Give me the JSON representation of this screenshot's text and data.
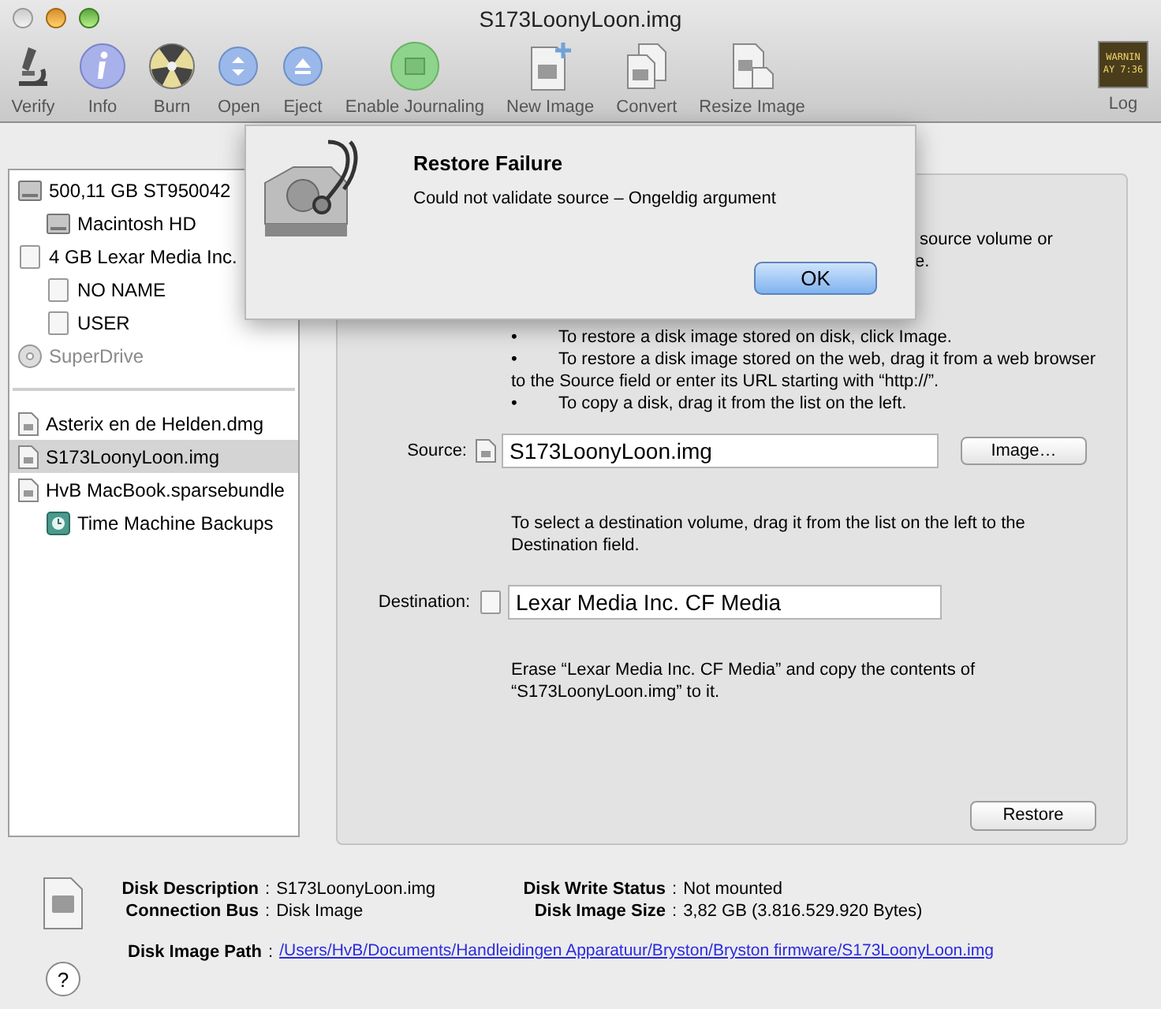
{
  "window": {
    "title": "S173LoonyLoon.img"
  },
  "toolbar": {
    "items": [
      {
        "label": "Verify",
        "kind": "microscope"
      },
      {
        "label": "Info",
        "kind": "info"
      },
      {
        "label": "Burn",
        "kind": "burn"
      },
      {
        "label": "Open",
        "kind": "open"
      },
      {
        "label": "Eject",
        "kind": "eject"
      },
      {
        "label": "Enable Journaling",
        "kind": "journal"
      },
      {
        "label": "New Image",
        "kind": "newimage"
      },
      {
        "label": "Convert",
        "kind": "convert"
      },
      {
        "label": "Resize Image",
        "kind": "resize"
      }
    ],
    "log": {
      "label": "Log",
      "screen_lines": [
        "WARNIN",
        "AY 7:36"
      ]
    }
  },
  "sidebar": {
    "groups": [
      {
        "items": [
          {
            "label": "500,11 GB ST950042",
            "kind": "disk",
            "selected": false,
            "disabled": false,
            "children": [
              {
                "label": "Macintosh HD",
                "kind": "disk",
                "selected": false,
                "disabled": false
              }
            ]
          },
          {
            "label": "4 GB Lexar Media Inc.",
            "kind": "removable",
            "selected": false,
            "disabled": false,
            "children": [
              {
                "label": "NO NAME",
                "kind": "removable",
                "selected": false,
                "disabled": false
              },
              {
                "label": "USER",
                "kind": "removable",
                "selected": false,
                "disabled": false
              }
            ]
          },
          {
            "label": "SuperDrive",
            "kind": "optical",
            "selected": false,
            "disabled": true
          }
        ]
      },
      {
        "items": [
          {
            "label": "Asterix en de Helden.dmg",
            "kind": "image",
            "selected": false,
            "disabled": false
          },
          {
            "label": "S173LoonyLoon.img",
            "kind": "image",
            "selected": true,
            "disabled": false
          },
          {
            "label": "HvB MacBook.sparsebundle",
            "kind": "image",
            "selected": false,
            "disabled": false,
            "children": [
              {
                "label": "Time Machine Backups",
                "kind": "timemachine",
                "selected": false,
                "disabled": false
              }
            ]
          }
        ]
      }
    ]
  },
  "restore_panel": {
    "intro_fragments": [
      "source volume or",
      "e."
    ],
    "source_help": [
      {
        "bullet": "•",
        "text": "To restore a disk image stored on disk, click Image."
      },
      {
        "bullet": "•",
        "text": "To restore a disk image stored on the web, drag it from a web browser to the Source field or enter its URL starting with “http://”."
      },
      {
        "bullet": "•",
        "text": "To copy a disk, drag it from the list on the left."
      }
    ],
    "source": {
      "label": "Source:",
      "value": "S173LoonyLoon.img",
      "button": "Image…"
    },
    "destination_help": "To select a destination volume, drag it from the list on the left to the Destination field.",
    "destination": {
      "label": "Destination:",
      "value": "Lexar Media Inc. CF Media"
    },
    "summary": "Erase “Lexar Media Inc. CF Media” and copy the contents of “S173LoonyLoon.img” to it.",
    "restore_button": "Restore"
  },
  "alert": {
    "title": "Restore Failure",
    "message": "Could not validate source – Ongeldig argument",
    "button": "OK"
  },
  "info": {
    "left": [
      {
        "label": "Disk Description",
        "value": "S173LoonyLoon.img"
      },
      {
        "label": "Connection Bus",
        "value": "Disk Image"
      }
    ],
    "right": [
      {
        "label": "Disk Write Status",
        "value": "Not mounted"
      },
      {
        "label": "Disk Image Size",
        "value": "3,82 GB (3.816.529.920 Bytes)"
      }
    ],
    "path": {
      "label": "Disk Image Path",
      "value": "/Users/HvB/Documents/Handleidingen Apparatuur/Bryston/Bryston firmware/S173LoonyLoon.img"
    },
    "separator": ":",
    "help_button": "?"
  }
}
